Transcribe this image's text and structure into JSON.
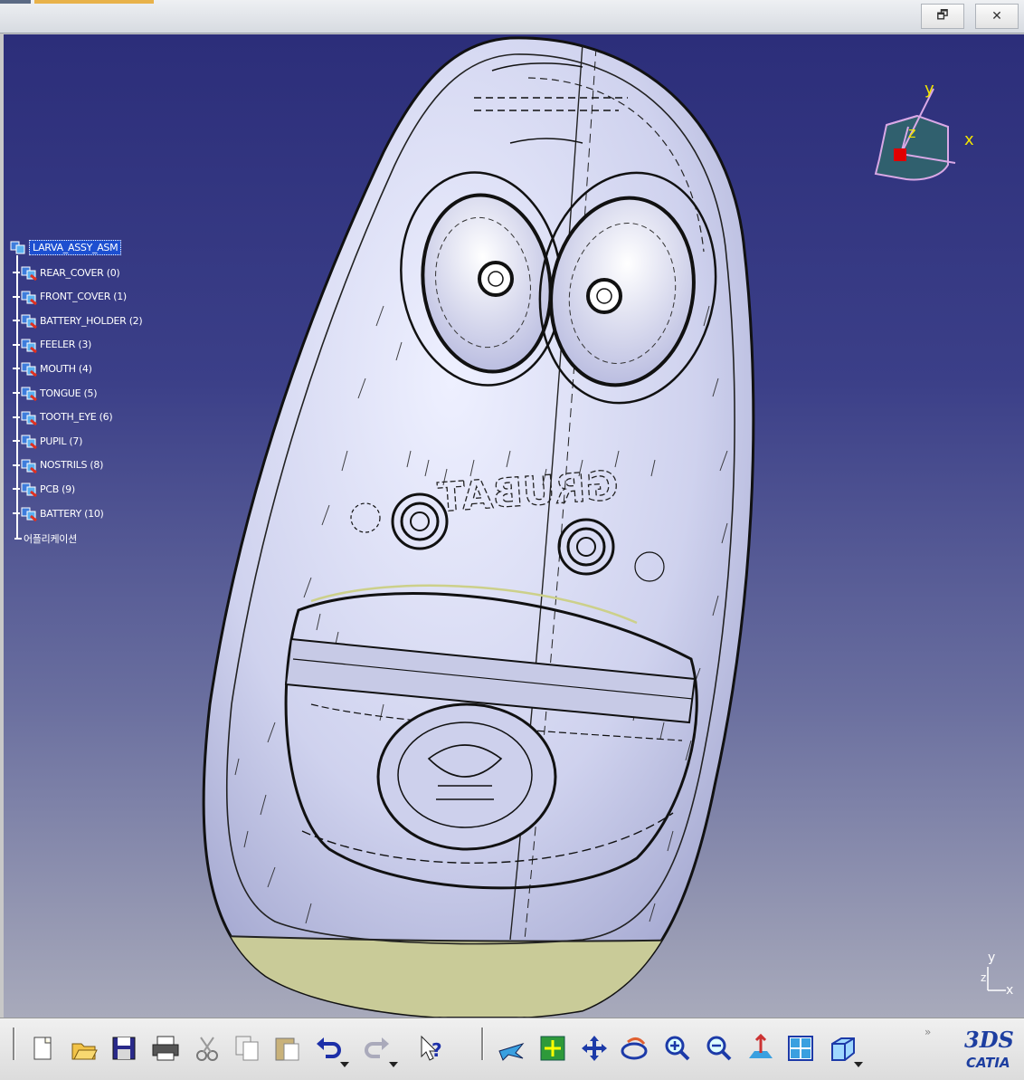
{
  "window": {
    "restore_label": "🗗",
    "close_label": "✕"
  },
  "spec_tree": {
    "root": "LARVA_ASSY_ASM",
    "children": [
      "REAR_COVER (0)",
      "FRONT_COVER (1)",
      "BATTERY_HOLDER (2)",
      "FEELER (3)",
      "MOUTH (4)",
      "TONGUE (5)",
      "TOOTH_EYE (6)",
      "PUPIL (7)",
      "NOSTRILS (8)",
      "PCB (9)",
      "BATTERY (10)"
    ],
    "applications": "어플리케이션"
  },
  "compass": {
    "x": "x",
    "y": "y",
    "z": "z"
  },
  "mini_axis": {
    "y": "y",
    "z": "z",
    "x": "x"
  },
  "model": {
    "engraving": "GRUBAT"
  },
  "toolbar": {
    "icons": [
      "new-icon",
      "open-icon",
      "save-icon",
      "print-icon",
      "cut-icon",
      "copy-icon",
      "paste-icon",
      "undo-icon",
      "redo-icon",
      "whats-this-icon",
      "fly-mode-icon",
      "fit-all-icon",
      "pan-icon",
      "rotate-icon",
      "zoom-in-icon",
      "zoom-out-icon",
      "normal-view-icon",
      "multi-view-icon",
      "iso-view-icon"
    ],
    "overflow": "»",
    "logo_ds": "3DS",
    "logo_text": "CATIA"
  },
  "colors": {
    "viewport_top": "#2c2e7a",
    "viewport_bottom": "#a8aabb",
    "model_fill": "#d6d8f0",
    "base_fill": "#c9cb98",
    "tree_highlight": "#1d4fd0"
  }
}
